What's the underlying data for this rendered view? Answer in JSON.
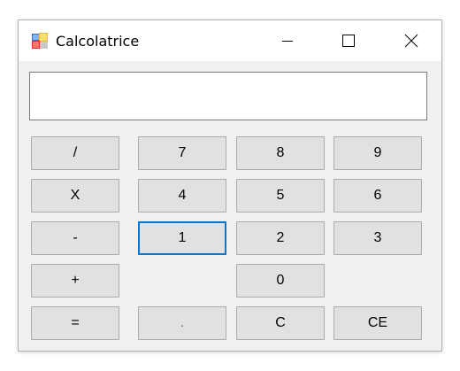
{
  "window": {
    "title": "Calcolatrice",
    "icon": "app-icon",
    "controls": [
      "minimize-icon",
      "maximize-icon",
      "close-icon"
    ]
  },
  "display": {
    "value": ""
  },
  "keys": {
    "divide": "/",
    "multiply": "X",
    "subtract": "-",
    "add": "+",
    "equals": "=",
    "d7": "7",
    "d8": "8",
    "d9": "9",
    "d4": "4",
    "d5": "5",
    "d6": "6",
    "d1": "1",
    "d2": "2",
    "d3": "3",
    "d0": "0",
    "decimal": ".",
    "clear": "C",
    "clear_entry": "CE"
  },
  "colors": {
    "focus": "#0078d7",
    "button_bg": "#e1e1e1",
    "window_bg": "#f0f0f0"
  }
}
